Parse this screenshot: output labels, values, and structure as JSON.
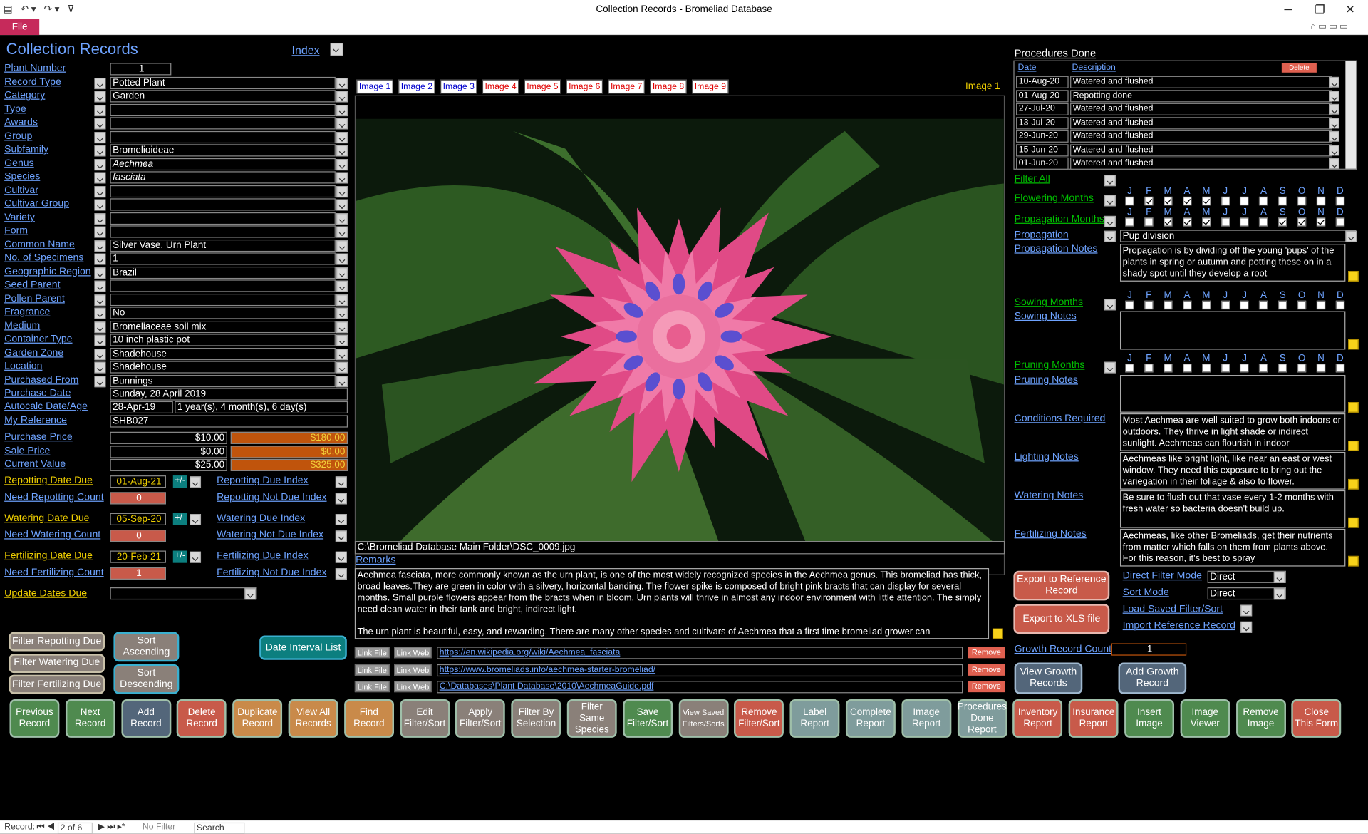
{
  "window": {
    "title": "Collection Records  -  Bromeliad Database",
    "file_tab": "File"
  },
  "form": {
    "title": "Collection Records",
    "index_label": "Index",
    "current_image_label": "Image 1"
  },
  "fields": [
    {
      "label": "Plant Number",
      "value": ""
    },
    {
      "label": "Record Type",
      "value": "Potted Plant"
    },
    {
      "label": "Category",
      "value": "Garden"
    },
    {
      "label": "Type",
      "value": ""
    },
    {
      "label": "Awards",
      "value": ""
    },
    {
      "label": "Group",
      "value": ""
    },
    {
      "label": "Subfamily",
      "value": "Bromelioideae"
    },
    {
      "label": "Genus",
      "value": "Aechmea"
    },
    {
      "label": "Species",
      "value": "fasciata"
    },
    {
      "label": "Cultivar",
      "value": ""
    },
    {
      "label": "Cultivar Group",
      "value": ""
    },
    {
      "label": "Variety",
      "value": ""
    },
    {
      "label": "Form",
      "value": ""
    },
    {
      "label": "Common Name",
      "value": "Silver Vase, Urn Plant"
    },
    {
      "label": "No. of Specimens",
      "value": "1"
    },
    {
      "label": "Geographic Region",
      "value": "Brazil"
    },
    {
      "label": "Seed Parent",
      "value": ""
    },
    {
      "label": "Pollen Parent",
      "value": ""
    },
    {
      "label": "Fragrance",
      "value": "No"
    },
    {
      "label": "Medium",
      "value": "Bromeliaceae soil mix"
    },
    {
      "label": "Container Type",
      "value": "10 inch plastic pot"
    },
    {
      "label": "Garden Zone",
      "value": "Shadehouse"
    },
    {
      "label": "Location",
      "value": "Shadehouse"
    },
    {
      "label": "Purchased From",
      "value": "Bunnings"
    }
  ],
  "plant_number": "1",
  "purchase": {
    "date_label": "Purchase Date",
    "date": "Sunday, 28 April 2019",
    "autocalc_label": "Autocalc Date/Age",
    "autocalc_date": "28-Apr-19",
    "age": "1 year(s), 4 month(s), 6 day(s)",
    "ref_label": "My Reference",
    "ref": "SHB027"
  },
  "prices": [
    {
      "label": "Purchase Price",
      "value": "$10.00",
      "total": "$180.00"
    },
    {
      "label": "Sale Price",
      "value": "$0.00",
      "total": "$0.00"
    },
    {
      "label": "Current Value",
      "value": "$25.00",
      "total": "$325.00"
    }
  ],
  "dates": [
    {
      "label": "Repotting Date Due",
      "value": "01-Aug-21",
      "count_label": "Need Repotting Count",
      "count": "0",
      "idx": "Repotting Due Index",
      "notidx": "Repotting Not Due Index"
    },
    {
      "label": "Watering Date Due",
      "value": "05-Sep-20",
      "count_label": "Need Watering Count",
      "count": "0",
      "idx": "Watering Due Index",
      "notidx": "Watering Not Due Index"
    },
    {
      "label": "Fertilizing Date Due",
      "value": "20-Feb-21",
      "count_label": "Need Fertilizing Count",
      "count": "1",
      "idx": "Fertilizing Due Index",
      "notidx": "Fertilizing Not Due Index"
    }
  ],
  "pm": "+/-",
  "update_dates_label": "Update Dates Due",
  "filter_buttons": [
    "Filter Repotting Due",
    "Filter Watering Due",
    "Filter Fertilizing Due"
  ],
  "sort_buttons": [
    "Sort\nAscending",
    "Sort\nDescending"
  ],
  "date_interval": "Date Interval List",
  "image_tabs": [
    "Image 1",
    "Image 2",
    "Image 3",
    "Image 4",
    "Image 5",
    "Image 6",
    "Image 7",
    "Image 8",
    "Image 9"
  ],
  "image_path": "C:\\Bromeliad Database Main Folder\\DSC_0009.jpg",
  "remarks_label": "Remarks",
  "remarks": "Aechmea fasciata, more commonly known as the urn plant, is one of the most widely recognized species in the Aechmea genus. This bromeliad has thick, broad leaves.They are green in color with a silvery, horizontal banding. The flower spike is composed of bright pink bracts that can display for several months. Small purple flowers appear from the bracts when in bloom. Urn plants will thrive in almost any indoor environment with little attention. The simply need clean water in their tank and bright, indirect light.\n\nThe urn plant is beautiful, easy, and rewarding. There are many other species and cultivars of Aechmea that a first time bromeliad grower can",
  "links": [
    {
      "url": "https://en.wikipedia.org/wiki/Aechmea_fasciata"
    },
    {
      "url": "https://www.bromeliads.info/aechmea-starter-bromeliad/"
    },
    {
      "url": "C:\\Databases\\Plant Database\\2010\\AechmeaGuide.pdf"
    }
  ],
  "link_file": "Link File",
  "link_web": "Link Web",
  "remove": "Remove",
  "procedures": {
    "title": "Procedures Done",
    "date_h": "Date",
    "desc_h": "Description",
    "delete": "Delete",
    "rows": [
      {
        "date": "10-Aug-20",
        "desc": "Watered and flushed"
      },
      {
        "date": "01-Aug-20",
        "desc": "Repotting done"
      },
      {
        "date": "27-Jul-20",
        "desc": "Watered and flushed"
      },
      {
        "date": "13-Jul-20",
        "desc": "Watered and flushed"
      },
      {
        "date": "29-Jun-20",
        "desc": "Watered and flushed"
      },
      {
        "date": "15-Jun-20",
        "desc": "Watered and flushed"
      },
      {
        "date": "01-Jun-20",
        "desc": "Watered and flushed"
      }
    ]
  },
  "months": [
    "J",
    "F",
    "M",
    "A",
    "M",
    "J",
    "J",
    "A",
    "S",
    "O",
    "N",
    "D"
  ],
  "filter_all": "Filter All",
  "flowering_label": "Flowering Months",
  "flowering": [
    0,
    1,
    1,
    1,
    1,
    0,
    0,
    0,
    0,
    0,
    0,
    0
  ],
  "prop_months_label": "Propagation Months",
  "prop_months": [
    0,
    0,
    1,
    1,
    1,
    0,
    0,
    0,
    1,
    1,
    1,
    0
  ],
  "propagation_label": "Propagation",
  "propagation": "Pup division",
  "prop_notes_label": "Propagation Notes",
  "prop_notes": "Propagation is by dividing off the young 'pups' of the plants in spring or autumn and potting these on in a shady spot until they develop a root",
  "sowing_label": "Sowing Months",
  "sowing_notes_label": "Sowing Notes",
  "pruning_label": "Pruning Months",
  "pruning_notes_label": "Pruning Notes",
  "conditions_label": "Conditions Required",
  "conditions": "Most Aechmea are well suited to grow both indoors or outdoors. They thrive in light shade or indirect sunlight. Aechmeas can flourish in indoor",
  "lighting_label": "Lighting Notes",
  "lighting": "Aechmeas like bright light, like near an east or west window. They need this exposure to bring out the variegation in their foliage & also to flower.",
  "watering_label": "Watering Notes",
  "watering": "Be sure to flush out that vase every 1-2 months with fresh water so bacteria doesn't build up.",
  "fertilizing_label": "Fertilizing Notes",
  "fertilizing": "Aechmeas, like other Bromeliads, get their nutrients from matter which falls on them from plants above. For this reason, it's best to spray",
  "export_ref": "Export to Reference\nRecord",
  "export_xls": "Export to XLS file",
  "direct_filter_label": "Direct Filter Mode",
  "direct_filter": "Direct",
  "sort_mode_label": "Sort Mode",
  "sort_mode": "Direct",
  "load_saved": "Load Saved Filter/Sort",
  "import_ref": "Import Reference Record",
  "growth_label": "Growth Record Count",
  "growth_count": "1",
  "view_growth": "View Growth\nRecords",
  "add_growth": "Add Growth\nRecord",
  "bottom_buttons": [
    {
      "label": "Previous\nRecord",
      "color": "#4f8a4f"
    },
    {
      "label": "Next\nRecord",
      "color": "#4f8a4f"
    },
    {
      "label": "Add\nRecord",
      "color": "#53667a"
    },
    {
      "label": "Delete\nRecord",
      "color": "#c85a4a"
    },
    {
      "label": "Duplicate\nRecord",
      "color": "#c98a4a"
    },
    {
      "label": "View All\nRecords",
      "color": "#c98a4a"
    },
    {
      "label": "Find\nRecord",
      "color": "#c98a4a"
    },
    {
      "label": "Edit\nFilter/Sort",
      "color": "#8a8079"
    },
    {
      "label": "Apply\nFilter/Sort",
      "color": "#8a8079"
    },
    {
      "label": "Filter By\nSelection",
      "color": "#8a8079"
    },
    {
      "label": "Filter\nSame\nSpecies",
      "color": "#8a8079"
    },
    {
      "label": "Save\nFilter/Sort",
      "color": "#4f8a4f"
    },
    {
      "label": "View Saved\nFilters/Sorts",
      "color": "#8a8079"
    },
    {
      "label": "Remove\nFilter/Sort",
      "color": "#c85a4a"
    },
    {
      "label": "Label\nReport",
      "color": "#7f9c9c"
    },
    {
      "label": "Complete\nReport",
      "color": "#7f9c9c"
    },
    {
      "label": "Image\nReport",
      "color": "#7f9c9c"
    },
    {
      "label": "Procedures\nDone Report",
      "color": "#7f9c9c"
    },
    {
      "label": "Inventory\nReport",
      "color": "#c85a4a"
    },
    {
      "label": "Insurance\nReport",
      "color": "#c85a4a"
    },
    {
      "label": "Insert\nImage",
      "color": "#4f8a4f"
    },
    {
      "label": "Image\nViewer",
      "color": "#4f8a4f"
    },
    {
      "label": "Remove\nImage",
      "color": "#4f8a4f"
    },
    {
      "label": "Close\nThis Form",
      "color": "#c85a4a"
    }
  ],
  "status": {
    "record_label": "Record:",
    "record": "2 of 6",
    "no_filter": "No Filter",
    "search": "Search"
  },
  "colors": {
    "accent_blue": "#6ea3ff",
    "due_yellow": "#f0d000",
    "months_green": "#00c000",
    "total_orange": "#c0540c",
    "count_red": "#c85a4a"
  }
}
